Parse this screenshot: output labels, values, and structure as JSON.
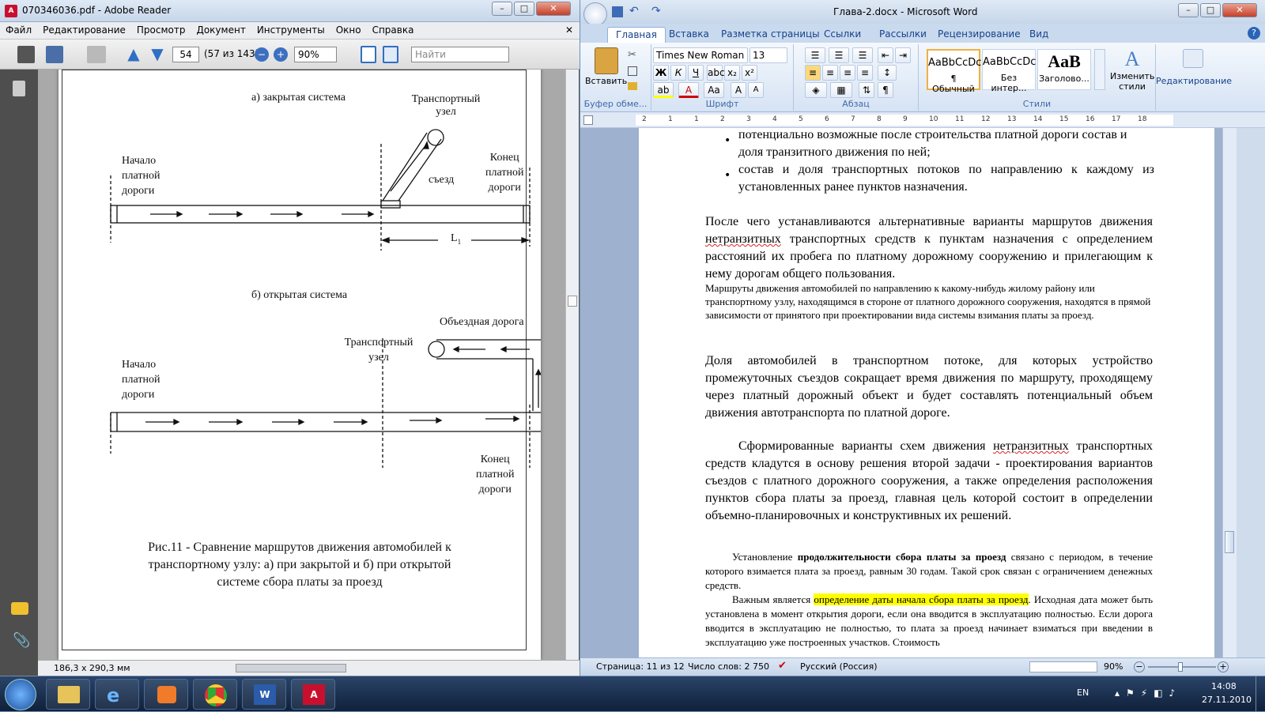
{
  "adobe": {
    "title": "070346036.pdf - Adobe Reader",
    "menu": [
      "Файл",
      "Редактирование",
      "Просмотр",
      "Документ",
      "Инструменты",
      "Окно",
      "Справка"
    ],
    "page_num": "54",
    "page_count": "(57 из 143)",
    "zoom": "90%",
    "search_placeholder": "Найти",
    "page_size": "186,3 x 290,3 мм",
    "fig": {
      "a_title": "а)  закрытая система",
      "b_title": "б)  открытая система",
      "transport_node_line1": "Транспортный",
      "transport_node_line2": "узел",
      "start_line1": "Начало",
      "start_line2": "платной",
      "start_line3": "дороги",
      "end_line1": "Конец",
      "end_line2": "платной",
      "end_line3": "дороги",
      "exit": "съезд",
      "length": "L",
      "length_sub": "1",
      "bypass": "Объездная дорога",
      "caption_line1": "Рис.11 - Сравнение маршрутов движения автомобилей к",
      "caption_line2": "транспортному узлу: а) при закрытой и б) при открытой",
      "caption_line3": "системе сбора платы за проезд"
    }
  },
  "word": {
    "title": "Глава-2.docx - Microsoft Word",
    "tabs": [
      "Главная",
      "Вставка",
      "Разметка страницы",
      "Ссылки",
      "Рассылки",
      "Рецензирование",
      "Вид"
    ],
    "font_name": "Times New Roman",
    "font_size": "13",
    "paste_label": "Вставить",
    "clipboard_group": "Буфер обме...",
    "font_group": "Шрифт",
    "para_group": "Абзац",
    "styles_group": "Стили",
    "styles": [
      {
        "preview": "AaBbCcDc",
        "name": "¶ Обычный"
      },
      {
        "preview": "AaBbCcDc",
        "name": "Без интер..."
      },
      {
        "preview": "AaB",
        "name": "Заголово..."
      }
    ],
    "change_styles": "Изменить стили",
    "editing": "Редактирование",
    "ruler_nums": [
      "2",
      "1",
      "1",
      "2",
      "3",
      "4",
      "5",
      "6",
      "7",
      "8",
      "9",
      "10",
      "11",
      "12",
      "13",
      "14",
      "15",
      "16",
      "17",
      "18"
    ],
    "doc": {
      "bullet1_line1": "потенциально возможные после строительства платной дороги состав и",
      "bullet1_line2": "доля транзитного движения по ней;",
      "bullet2": "состав и доля транспортных потоков по направлению к каждому из установленных ранее пунктов назначения.",
      "p1_a": "После чего устанавливаются альтернативные варианты маршрутов движения ",
      "p1_sq": "нетранзитных",
      "p1_b": " транспортных средств к пунктам назначения с определением расстояний их пробега по платному дорожному сооружению и прилегающим к нему дорогам общего пользования.",
      "p2": "Маршруты движения автомобилей по направлению к какому-нибудь жилому району или транспортному узлу, находящимся в стороне от платного дорожного сооружения, находятся в прямой зависимости от принятого при проектировании вида системы взимания платы за проезд.",
      "p3": "Доля автомобилей в транспортном потоке, для которых устройство промежуточных съездов сокращает время движения по маршруту, проходящему через платный дорожный объект и  будет составлять потенциальный объем движения автотранспорта по платной дороге.",
      "p4_a": "Сформированные варианты схем движения ",
      "p4_sq": "нетранзитных",
      "p4_b": " транспортных средств кладутся в основу решения второй задачи - проектирования вариантов съездов с платного дорожного сооружения, а также определения расположения пунктов сбора платы за проезд, главная цель которой состоит в определении объемно-планировочных и конструктивных их решений.",
      "p5_a": "Установление ",
      "p5_bold": "продолжительности сбора платы за проезд",
      "p5_b": " связано с периодом, в течение которого взимается плата за проезд, равным 30 годам. Такой срок связан с ограничением денежных средств.",
      "p6_a": "Важным является ",
      "p6_hl": "определение даты начала сбора платы за проезд",
      "p6_b": ". Исходная дата может быть установлена в момент открытия дороги, если она вводится в эксплуатацию полностью. Если дорога вводится в эксплуатацию не полностью, то плата за проезд начинает взиматься  при введении в эксплуатацию уже построенных участков. Стоимость"
    },
    "status_page": "Страница: 11 из 12",
    "status_words": "Число слов: 2 750",
    "status_lang": "Русский (Россия)",
    "zoom": "90%",
    "highlight_color": "#ffff00"
  },
  "taskbar": {
    "lang": "EN",
    "time": "14:08",
    "date": "27.11.2010"
  }
}
